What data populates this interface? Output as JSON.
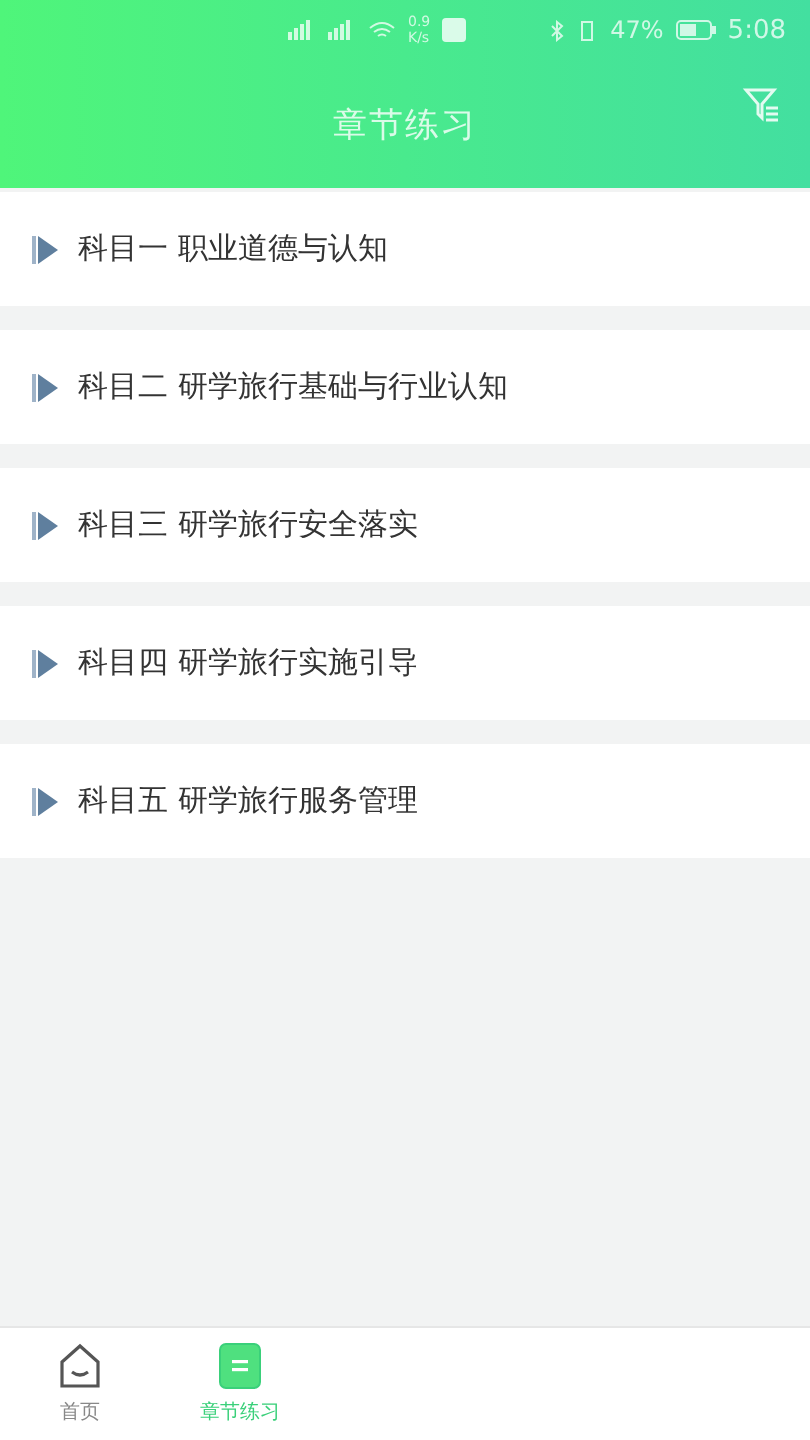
{
  "status_bar": {
    "speed_value": "0.9",
    "speed_unit": "K/s",
    "battery": "47%",
    "time": "5:08"
  },
  "header": {
    "title": "章节练习"
  },
  "chapters": [
    {
      "label": "科目一 职业道德与认知"
    },
    {
      "label": "科目二 研学旅行基础与行业认知"
    },
    {
      "label": "科目三 研学旅行安全落实"
    },
    {
      "label": "科目四 研学旅行实施引导"
    },
    {
      "label": "科目五 研学旅行服务管理"
    }
  ],
  "bottom_nav": [
    {
      "label": "首页",
      "kind": "home",
      "selected": false
    },
    {
      "label": "章节练习",
      "kind": "chapters",
      "selected": true
    }
  ]
}
